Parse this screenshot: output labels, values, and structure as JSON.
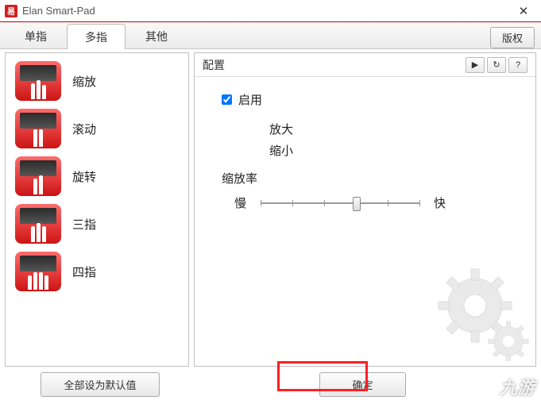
{
  "titlebar": {
    "title": "Elan Smart-Pad",
    "close": "✕"
  },
  "tabs": {
    "single": "单指",
    "multi": "多指",
    "other": "其他",
    "copyright": "版权"
  },
  "gestures": {
    "zoom": "缩放",
    "scroll": "滚动",
    "rotate": "旋转",
    "three": "三指",
    "four": "四指"
  },
  "config": {
    "header": "配置",
    "play": "▶",
    "refresh": "↻",
    "help": "?",
    "enable": "启用",
    "zoom_in": "放大",
    "zoom_out": "缩小",
    "rate": "缩放率",
    "slow": "慢",
    "fast": "快"
  },
  "footer": {
    "reset_all": "全部设为默认值",
    "ok": "确定"
  },
  "watermark": "九游"
}
